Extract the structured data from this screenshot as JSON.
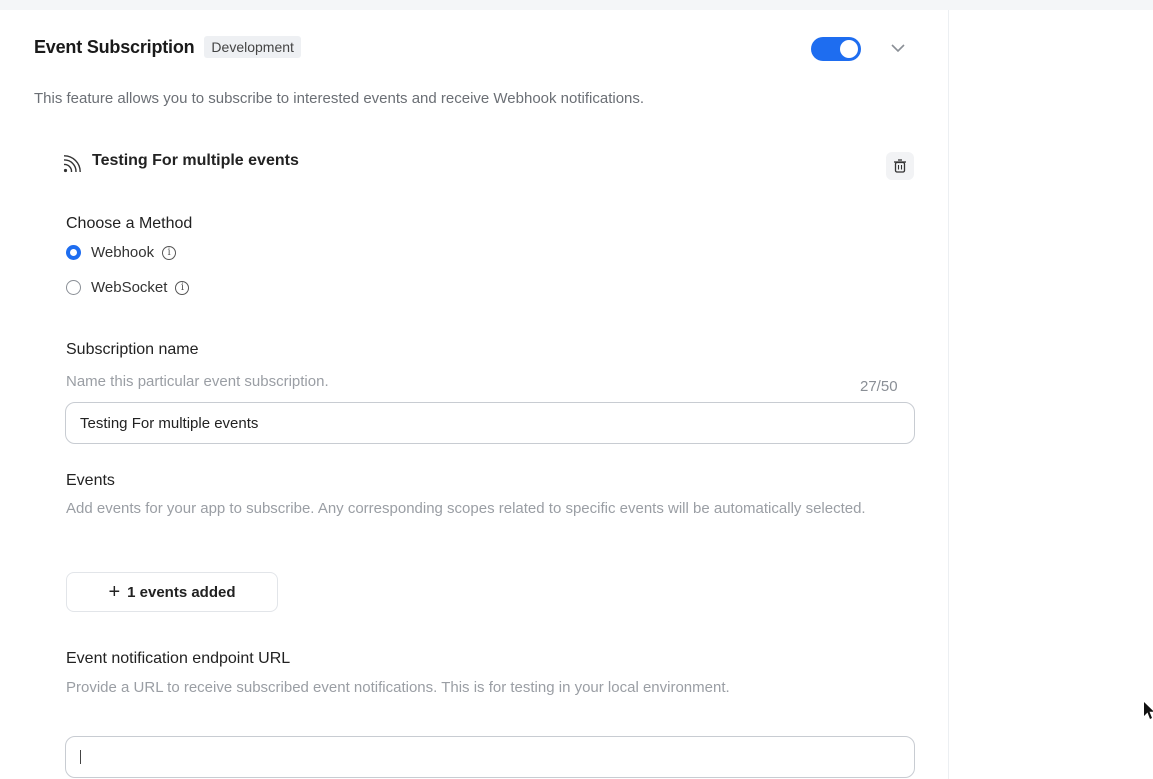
{
  "header": {
    "title": "Event Subscription",
    "badge": "Development",
    "toggle_on": true,
    "description": "This feature allows you to subscribe to interested events and receive Webhook notifications."
  },
  "subscription": {
    "title": "Testing For multiple events",
    "method": {
      "label": "Choose a Method",
      "options": [
        {
          "label": "Webhook",
          "selected": true
        },
        {
          "label": "WebSocket",
          "selected": false
        }
      ]
    },
    "name_field": {
      "label": "Subscription name",
      "help": "Name this particular event subscription.",
      "counter": "27/50",
      "value": "Testing For multiple events"
    },
    "events": {
      "label": "Events",
      "help": "Add events for your app to subscribe. Any corresponding scopes related to specific events will be automatically selected.",
      "button_label": "1 events added"
    },
    "endpoint": {
      "label": "Event notification endpoint URL",
      "help": "Provide a URL to receive subscribed event notifications. This is for testing in your local environment.",
      "value": ""
    }
  },
  "colors": {
    "accent": "#1e6df0",
    "muted_text": "#9a9ea4"
  },
  "icons": [
    "chevron-down-icon",
    "rss-icon",
    "trash-icon",
    "info-icon",
    "plus-icon",
    "mouse-cursor-icon"
  ]
}
